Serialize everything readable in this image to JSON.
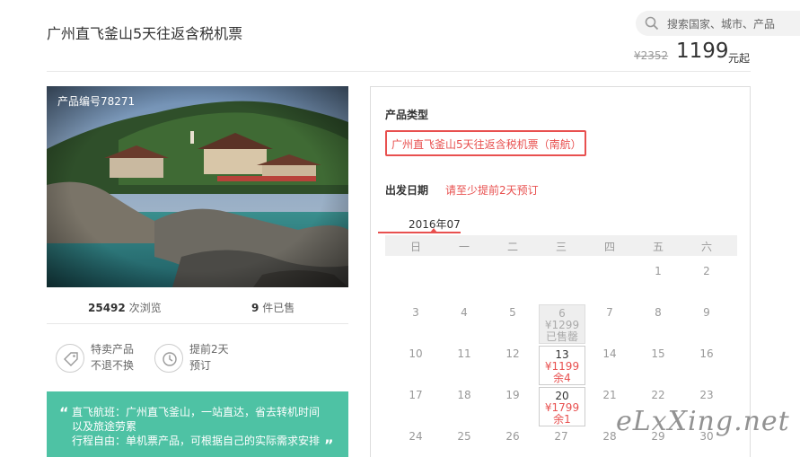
{
  "header": {
    "title": "广州直飞釜山5天往返含税机票",
    "search_placeholder": "搜索国家、城市、产品",
    "price_original": "¥2352",
    "price_current": "1199",
    "price_unit": "元起"
  },
  "gallery": {
    "product_code": "产品编号78271"
  },
  "stats": {
    "views_count": "25492",
    "views_label": "次浏览",
    "sold_count": "9",
    "sold_label": "件已售"
  },
  "features": [
    {
      "icon": "tag-icon",
      "line1": "特卖产品",
      "line2": "不退不换"
    },
    {
      "icon": "clock-icon",
      "line1": "提前2天",
      "line2": "预订"
    }
  ],
  "highlights": {
    "lines": [
      "直飞航班：广州直飞釜山，一站直达，省去转机时间",
      "以及旅途劳累",
      "行程自由：单机票产品，可根据自己的实际需求安排"
    ]
  },
  "booking": {
    "product_type_label": "产品类型",
    "product_option": "广州直飞釜山5天往返含税机票（南航）",
    "departure_label": "出发日期",
    "departure_note": "请至少提前2天预订",
    "month": "2016年07",
    "weekdays": [
      "日",
      "一",
      "二",
      "三",
      "四",
      "五",
      "六"
    ],
    "days": {
      "d1": "1",
      "d2": "2",
      "d3": "3",
      "d4": "4",
      "d5": "5",
      "d6": "6",
      "d7": "7",
      "d8": "8",
      "d9": "9",
      "d10": "10",
      "d11": "11",
      "d12": "12",
      "d13": "13",
      "d14": "14",
      "d15": "15",
      "d16": "16",
      "d17": "17",
      "d18": "18",
      "d19": "19",
      "d20": "20",
      "d21": "21",
      "d22": "22",
      "d23": "23",
      "d24": "24",
      "d25": "25",
      "d26": "26",
      "d27": "27",
      "d28": "28",
      "d29": "29",
      "d30": "30"
    },
    "special": {
      "d6": {
        "price": "¥1299",
        "status": "已售罄"
      },
      "d13": {
        "price": "¥1199",
        "status": "余4"
      },
      "d20": {
        "price": "¥1799",
        "status": "余1"
      }
    }
  },
  "watermark": "eLxXing.net",
  "colors": {
    "accent": "#e8504f",
    "green": "#4ec2a4"
  }
}
